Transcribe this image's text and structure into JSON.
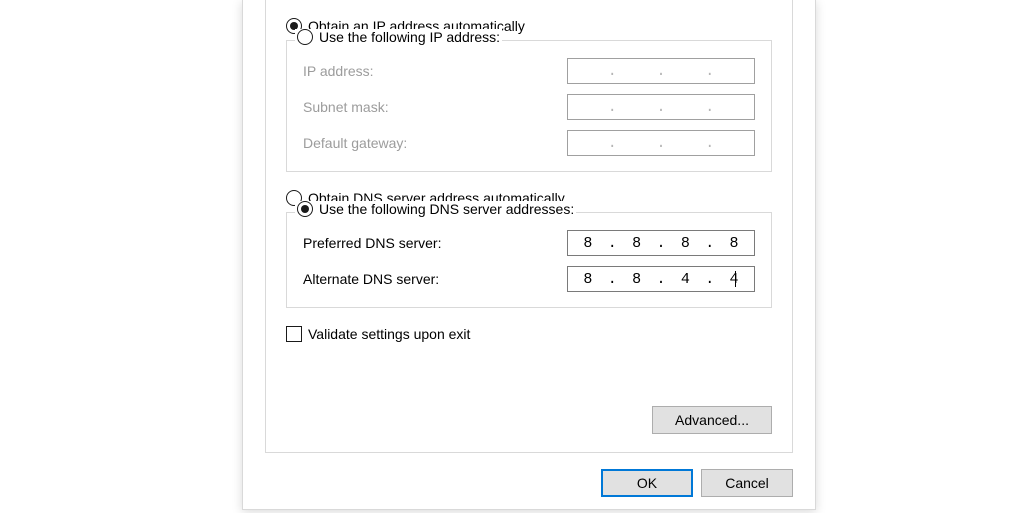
{
  "ip_section": {
    "auto_label": "Obtain an IP address automatically",
    "manual_label": "Use the following IP address:",
    "auto_selected": true,
    "fields": {
      "ip_label": "IP address:",
      "subnet_label": "Subnet mask:",
      "gateway_label": "Default gateway:",
      "ip_value": [
        "",
        "",
        "",
        ""
      ],
      "subnet_value": [
        "",
        "",
        "",
        ""
      ],
      "gateway_value": [
        "",
        "",
        "",
        ""
      ]
    }
  },
  "dns_section": {
    "auto_label": "Obtain DNS server address automatically",
    "manual_label": "Use the following DNS server addresses:",
    "manual_selected": true,
    "fields": {
      "preferred_label": "Preferred DNS server:",
      "alternate_label": "Alternate DNS server:",
      "preferred_value": [
        "8",
        "8",
        "8",
        "8"
      ],
      "alternate_value": [
        "8",
        "8",
        "4",
        "4"
      ]
    }
  },
  "validate_label": "Validate settings upon exit",
  "validate_checked": false,
  "buttons": {
    "advanced": "Advanced...",
    "ok": "OK",
    "cancel": "Cancel"
  }
}
